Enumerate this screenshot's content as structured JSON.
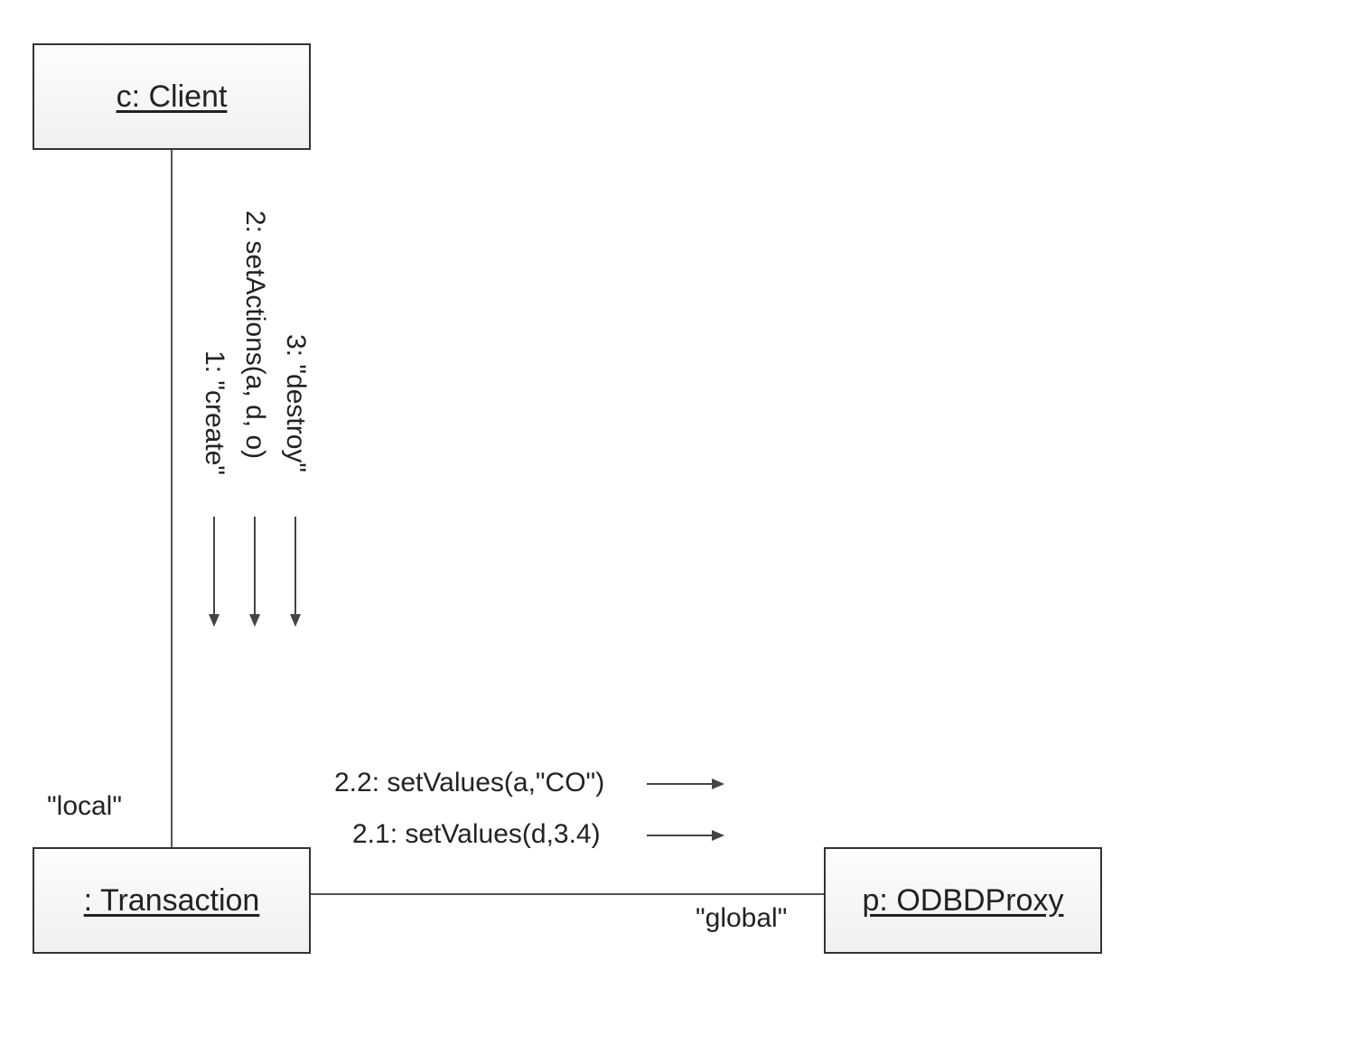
{
  "nodes": {
    "client": {
      "label": "c: Client"
    },
    "transaction": {
      "label": ": Transaction"
    },
    "proxy": {
      "label": "p: ODBDProxy"
    }
  },
  "edges": {
    "client_transaction": {
      "end_label": "\"local\"",
      "messages": {
        "m1": "1: \"create\"",
        "m2": "2: setActions(a, d, o)",
        "m3": "3: \"destroy\""
      }
    },
    "transaction_proxy": {
      "end_label": "\"global\"",
      "messages": {
        "m21": "2.1: setValues(d,3.4)",
        "m22": "2.2: setValues(a,\"CO\")"
      }
    }
  }
}
